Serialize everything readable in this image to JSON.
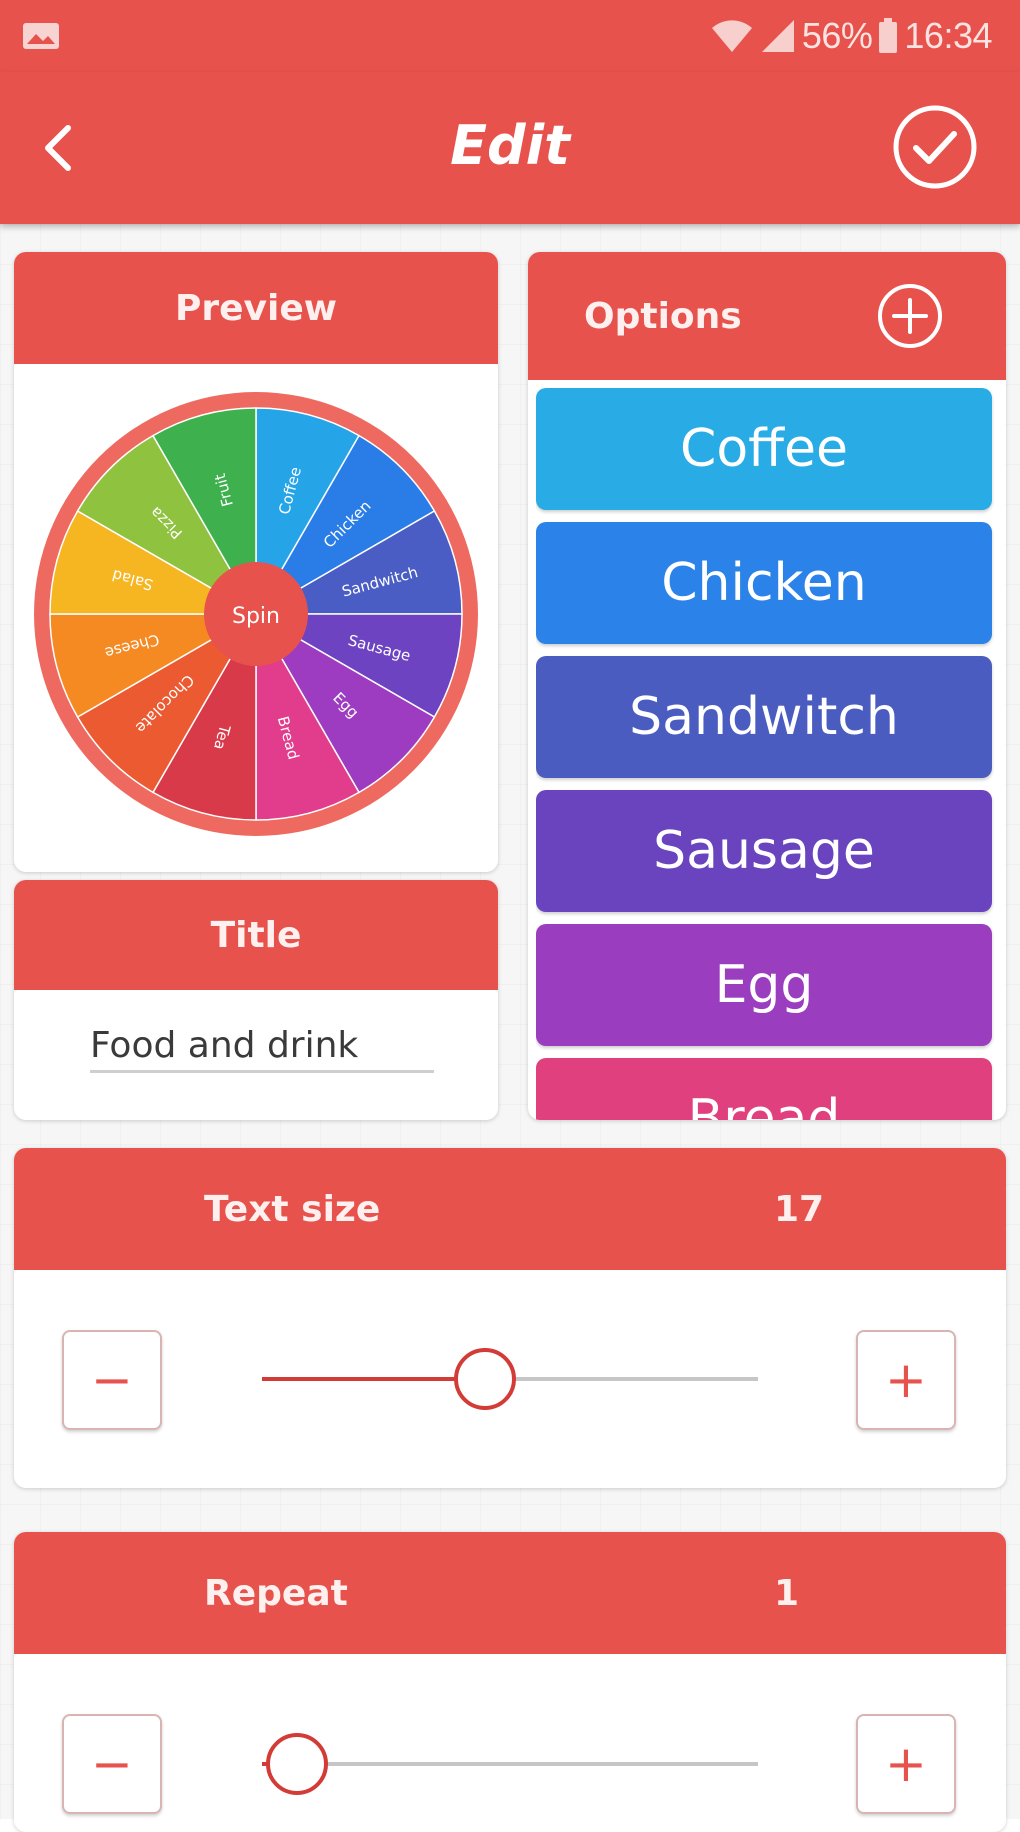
{
  "status_bar": {
    "gallery_icon": "image-icon",
    "battery_percent": "56%",
    "time": "16:34"
  },
  "app_bar": {
    "title": "Edit",
    "back_icon": "chevron-left-icon",
    "confirm_icon": "check-circle-icon"
  },
  "preview": {
    "header": "Preview",
    "wheel_center_label": "Spin",
    "wheel_segments": [
      {
        "label": "Coffee",
        "color": "#26a4e8"
      },
      {
        "label": "Chicken",
        "color": "#2a7de6"
      },
      {
        "label": "Sandwitch",
        "color": "#4a5dc4"
      },
      {
        "label": "Sausage",
        "color": "#6d43c2"
      },
      {
        "label": "Egg",
        "color": "#9d3cc0"
      },
      {
        "label": "Bread",
        "color": "#e23c8c"
      },
      {
        "label": "Tea",
        "color": "#d93a4a"
      },
      {
        "label": "Chocolate",
        "color": "#ec5a32"
      },
      {
        "label": "Cheese",
        "color": "#f58a23"
      },
      {
        "label": "Salad",
        "color": "#f6b622"
      },
      {
        "label": "Pizza",
        "color": "#8fc23f"
      },
      {
        "label": "Fruit",
        "color": "#3fb04e"
      }
    ],
    "rim_color": "#ee6a61",
    "center_color": "#e8524d"
  },
  "title_section": {
    "header": "Title",
    "value": "Food and drink"
  },
  "options": {
    "header": "Options",
    "add_icon": "plus-circle-icon",
    "items": [
      {
        "label": "Coffee",
        "color": "#29abe6"
      },
      {
        "label": "Chicken",
        "color": "#2b82e8"
      },
      {
        "label": "Sandwitch",
        "color": "#4b5cc0"
      },
      {
        "label": "Sausage",
        "color": "#6a43bf"
      },
      {
        "label": "Egg",
        "color": "#9b3dbf"
      },
      {
        "label": "Bread",
        "color": "#e0407e"
      }
    ]
  },
  "text_size": {
    "label": "Text size",
    "value": "17",
    "slider_fraction": 0.45,
    "minus_symbol": "−",
    "plus_symbol": "+"
  },
  "repeat": {
    "label": "Repeat",
    "value": "1",
    "slider_fraction": 0.07,
    "minus_symbol": "−",
    "plus_symbol": "+"
  },
  "colors": {
    "primary": "#e8524d",
    "slider_active": "#d33b37"
  }
}
